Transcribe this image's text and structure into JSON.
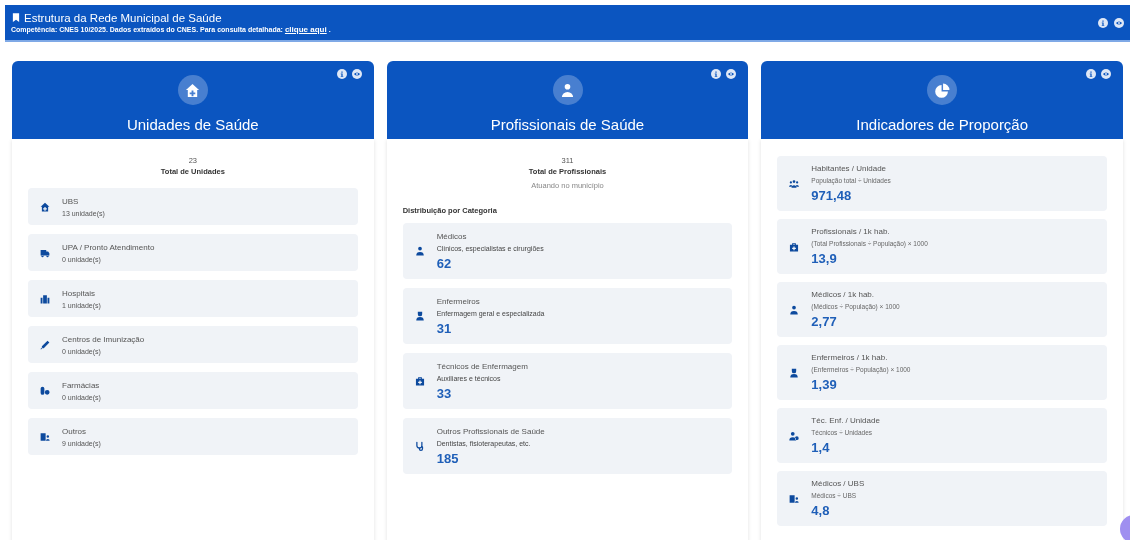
{
  "header": {
    "title": "Estrutura da Rede Municipal de Saúde",
    "subtitle": "Competência: CNES 10/2025. Dados extraídos do CNES. Para consulta detalhada:",
    "link": "clique aqui",
    "link_after": "."
  },
  "cards": [
    {
      "kind": "units",
      "title": "Unidades de Saúde",
      "total": "23",
      "total_label": "Total de Unidades",
      "items": [
        {
          "name": "UBS",
          "count": "13 unidade(s)"
        },
        {
          "name": "UPA / Pronto Atendimento",
          "count": "0 unidade(s)"
        },
        {
          "name": "Hospitais",
          "count": "1 unidade(s)"
        },
        {
          "name": "Centros de Imunização",
          "count": "0 unidade(s)"
        },
        {
          "name": "Farmácias",
          "count": "0 unidade(s)"
        },
        {
          "name": "Outros",
          "count": "9 unidade(s)"
        }
      ]
    },
    {
      "kind": "professionals",
      "title": "Profissionais de Saúde",
      "total": "311",
      "total_label": "Total de Profissionais",
      "note": "Atuando no município",
      "section": "Distribuição por Categoria",
      "items": [
        {
          "name": "Médicos",
          "desc": "Clínicos, especialistas e cirurgiões",
          "value": "62"
        },
        {
          "name": "Enfermeiros",
          "desc": "Enfermagem geral e especializada",
          "value": "31"
        },
        {
          "name": "Técnicos de Enfermagem",
          "desc": "Auxiliares e técnicos",
          "value": "33"
        },
        {
          "name": "Outros Profissionais de Saúde",
          "desc": "Dentistas, fisioterapeutas, etc.",
          "value": "185"
        }
      ]
    },
    {
      "kind": "indicators",
      "title": "Indicadores de Proporção",
      "items": [
        {
          "name": "Habitantes / Unidade",
          "formula": "População total ÷ Unidades",
          "value": "971,48"
        },
        {
          "name": "Profissionais / 1k hab.",
          "formula": "(Total Profissionais ÷ População) × 1000",
          "value": "13,9"
        },
        {
          "name": "Médicos / 1k hab.",
          "formula": "(Médicos ÷ População) × 1000",
          "value": "2,77"
        },
        {
          "name": "Enfermeiros / 1k hab.",
          "formula": "(Enfermeiros ÷ População) × 1000",
          "value": "1,39"
        },
        {
          "name": "Téc. Enf. / Unidade",
          "formula": "Técnicos ÷ Unidades",
          "value": "1,4"
        },
        {
          "name": "Médicos / UBS",
          "formula": "Médicos ÷ UBS",
          "value": "4,8"
        }
      ]
    }
  ]
}
